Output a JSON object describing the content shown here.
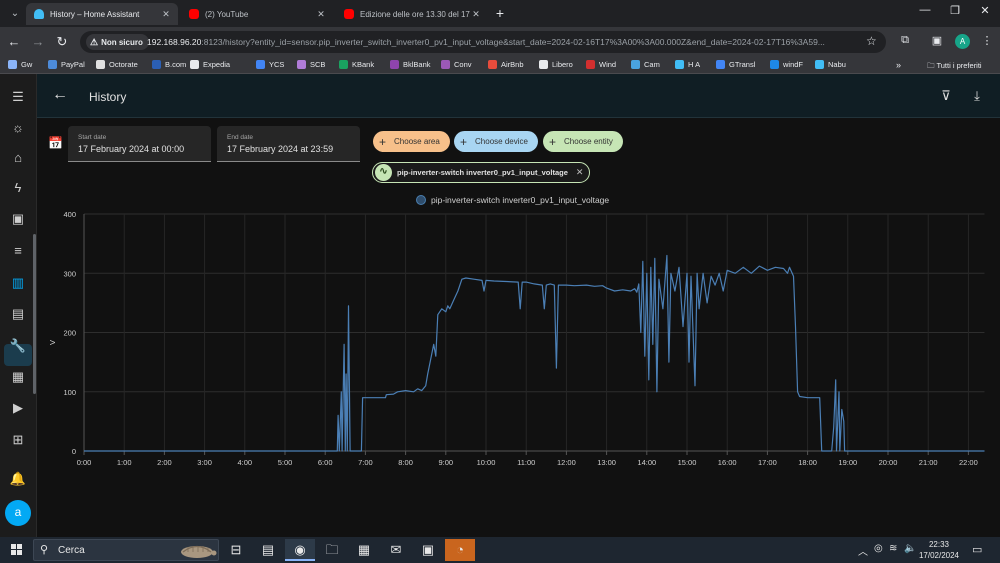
{
  "browser": {
    "tabs": [
      {
        "title": "History – Home Assistant",
        "favicon": "home-assistant-icon",
        "active": true
      },
      {
        "title": "(2) YouTube",
        "favicon": "youtube-icon",
        "active": false
      },
      {
        "title": "Edizione delle ore 13.30 del 17/",
        "favicon": "youtube-icon",
        "active": false
      }
    ],
    "security_label": "Non sicuro",
    "url_host": "192.168.96.20",
    "url_rest": ":8123/history?entity_id=sensor.pip_inverter_switch_inverter0_pv1_input_voltage&start_date=2024-02-16T17%3A00%3A00.000Z&end_date=2024-02-17T16%3A59...",
    "profile_initial": "A",
    "bookmarks": [
      "Gw",
      "PayPal",
      "Octorate",
      "B.com",
      "Expedia",
      "YCS",
      "SCB",
      "KBank",
      "BklBank",
      "Conv",
      "AirBnb",
      "Libero",
      "Wind",
      "Cam",
      "H A",
      "GTransl",
      "windF",
      "Nabu"
    ],
    "bookmarks_more": "»",
    "all_bookmarks": "Tutti i preferiti"
  },
  "ha": {
    "title": "History",
    "start_date": {
      "label": "Start date",
      "value": "17 February 2024 at 00:00"
    },
    "end_date": {
      "label": "End date",
      "value": "17 February 2024 at 23:59"
    },
    "chips": {
      "area": "Choose area",
      "device": "Choose device",
      "entity": "Choose entity"
    },
    "selected_entity": "pip-inverter-switch inverter0_pv1_input_voltage",
    "user_initial": "a",
    "accent": "#03a9f4"
  },
  "chart_data": {
    "type": "line",
    "ylabel": "V",
    "ylim": [
      0,
      400
    ],
    "yticks": [
      0,
      100,
      200,
      300,
      400
    ],
    "xticks": [
      "0:00",
      "1:00",
      "2:00",
      "3:00",
      "4:00",
      "5:00",
      "6:00",
      "7:00",
      "8:00",
      "9:00",
      "10:00",
      "11:00",
      "12:00",
      "13:00",
      "14:00",
      "15:00",
      "16:00",
      "17:00",
      "18:00",
      "19:00",
      "20:00",
      "21:00",
      "22:00"
    ],
    "xlim_hours": [
      0,
      22.4
    ],
    "grid": true,
    "legend_position": "top-center",
    "series": [
      {
        "name": "pip-inverter-switch inverter0_pv1_input_voltage",
        "color": "#4b7fb5",
        "points": [
          [
            0,
            0
          ],
          [
            6.3,
            0
          ],
          [
            6.32,
            60
          ],
          [
            6.35,
            0
          ],
          [
            6.4,
            100
          ],
          [
            6.42,
            0
          ],
          [
            6.47,
            180
          ],
          [
            6.5,
            0
          ],
          [
            6.52,
            130
          ],
          [
            6.55,
            0
          ],
          [
            6.58,
            245
          ],
          [
            6.62,
            0
          ],
          [
            6.9,
            0
          ],
          [
            6.93,
            90
          ],
          [
            7.5,
            90
          ],
          [
            7.52,
            95
          ],
          [
            7.7,
            96
          ],
          [
            7.8,
            100
          ],
          [
            8.0,
            102
          ],
          [
            8.2,
            100
          ],
          [
            8.3,
            105
          ],
          [
            8.4,
            102
          ],
          [
            8.5,
            110
          ],
          [
            8.55,
            130
          ],
          [
            8.7,
            180
          ],
          [
            8.75,
            160
          ],
          [
            8.8,
            230
          ],
          [
            8.9,
            240
          ],
          [
            9.0,
            235
          ],
          [
            9.05,
            245
          ],
          [
            9.1,
            240
          ],
          [
            9.2,
            255
          ],
          [
            9.3,
            270
          ],
          [
            9.4,
            290
          ],
          [
            9.5,
            292
          ],
          [
            9.7,
            290
          ],
          [
            9.9,
            288
          ],
          [
            9.95,
            270
          ],
          [
            10.0,
            288
          ],
          [
            10.2,
            287
          ],
          [
            10.5,
            286
          ],
          [
            10.8,
            285
          ],
          [
            10.85,
            240
          ],
          [
            10.9,
            285
          ],
          [
            11.0,
            285
          ],
          [
            11.2,
            282
          ],
          [
            11.4,
            280
          ],
          [
            11.45,
            240
          ],
          [
            11.5,
            280
          ],
          [
            11.6,
            282
          ],
          [
            11.7,
            280
          ],
          [
            11.75,
            140
          ],
          [
            11.8,
            280
          ],
          [
            12.0,
            280
          ],
          [
            12.2,
            279
          ],
          [
            12.5,
            280
          ],
          [
            12.7,
            278
          ],
          [
            12.9,
            279
          ],
          [
            13.0,
            275
          ],
          [
            13.2,
            270
          ],
          [
            13.4,
            272
          ],
          [
            13.6,
            270
          ],
          [
            13.7,
            274
          ],
          [
            13.75,
            268
          ],
          [
            13.8,
            282
          ],
          [
            13.85,
            200
          ],
          [
            13.9,
            320
          ],
          [
            13.95,
            160
          ],
          [
            14.0,
            300
          ],
          [
            14.05,
            120
          ],
          [
            14.1,
            310
          ],
          [
            14.15,
            180
          ],
          [
            14.2,
            325
          ],
          [
            14.25,
            100
          ],
          [
            14.3,
            290
          ],
          [
            14.4,
            240
          ],
          [
            14.5,
            330
          ],
          [
            14.55,
            150
          ],
          [
            14.6,
            300
          ],
          [
            14.7,
            270
          ],
          [
            14.8,
            310
          ],
          [
            14.9,
            210
          ],
          [
            15.0,
            300
          ],
          [
            15.05,
            150
          ],
          [
            15.1,
            295
          ],
          [
            15.2,
            110
          ],
          [
            15.25,
            300
          ],
          [
            15.3,
            240
          ],
          [
            15.4,
            300
          ],
          [
            15.5,
            250
          ],
          [
            15.6,
            295
          ],
          [
            15.7,
            280
          ],
          [
            15.8,
            300
          ],
          [
            15.9,
            270
          ],
          [
            16.0,
            305
          ],
          [
            16.2,
            300
          ],
          [
            16.4,
            310
          ],
          [
            16.6,
            300
          ],
          [
            16.8,
            312
          ],
          [
            17.0,
            305
          ],
          [
            17.2,
            310
          ],
          [
            17.4,
            308
          ],
          [
            17.5,
            300
          ],
          [
            17.55,
            310
          ],
          [
            17.65,
            295
          ],
          [
            17.7,
            210
          ],
          [
            17.75,
            100
          ],
          [
            17.8,
            92
          ],
          [
            18.0,
            90
          ],
          [
            18.2,
            90
          ],
          [
            18.3,
            90
          ],
          [
            18.35,
            0
          ],
          [
            18.6,
            0
          ],
          [
            18.65,
            40
          ],
          [
            18.7,
            120
          ],
          [
            18.72,
            0
          ],
          [
            18.78,
            100
          ],
          [
            18.8,
            0
          ],
          [
            18.85,
            70
          ],
          [
            18.9,
            50
          ],
          [
            18.92,
            0
          ],
          [
            22.4,
            0
          ]
        ]
      }
    ]
  },
  "taskbar": {
    "search_placeholder": "Cerca",
    "time": "22:33",
    "date": "17/02/2024"
  }
}
